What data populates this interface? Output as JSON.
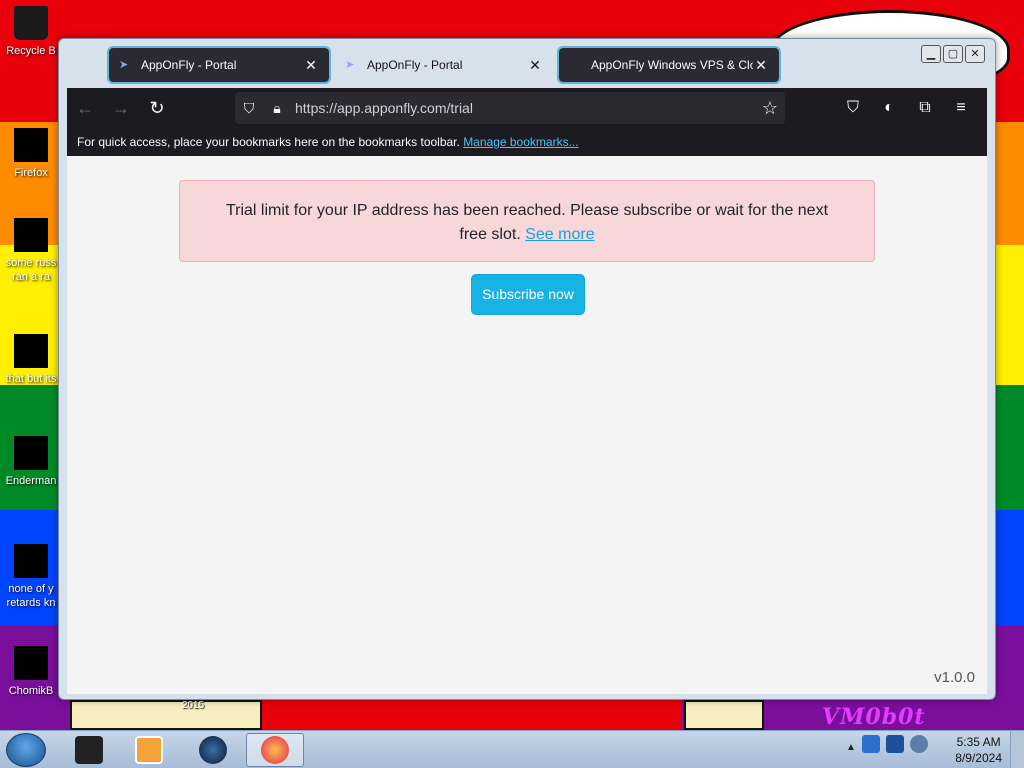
{
  "desktop": {
    "icons": [
      {
        "label": "Recycle B",
        "color": "#222222"
      },
      {
        "label": "Firefox",
        "color": "#000000"
      },
      {
        "label": "some russ",
        "label2": "ran a ra",
        "color": "#000000"
      },
      {
        "label": "that but its",
        "color": "#000000"
      },
      {
        "label": "Enderman",
        "color": "#000000"
      },
      {
        "label": "none of y",
        "label2": "retards kn",
        "color": "#000000"
      },
      {
        "label": "ChomikB",
        "color": "#000000"
      }
    ],
    "year_text": "2015",
    "watermark_text": "VM0b0t"
  },
  "browser": {
    "tabs": [
      {
        "title": "AppOnFly - Portal",
        "close": "✕",
        "active": true
      },
      {
        "title": "AppOnFly - Portal",
        "close": "✕",
        "active": false
      },
      {
        "title": "AppOnFly Windows VPS & Clo",
        "close": "✕",
        "active": false
      }
    ],
    "url": "https://app.apponfly.com/trial",
    "bookmarks_bar": {
      "text": "For quick access, place your bookmarks here on the bookmarks toolbar.",
      "link": "Manage bookmarks..."
    }
  },
  "page": {
    "alert_text": "Trial limit for your IP address has been reached. Please subscribe or wait for the next free slot.",
    "alert_link": "See more",
    "subscribe_label": "Subscribe now",
    "version": "v1.0.0"
  },
  "taskbar": {
    "time": "5:35 AM",
    "date": "8/9/2024"
  },
  "colors": {
    "accent": "#17b3e4",
    "alert_bg": "#f8d7da",
    "browser_chrome": "#1c1b22"
  }
}
